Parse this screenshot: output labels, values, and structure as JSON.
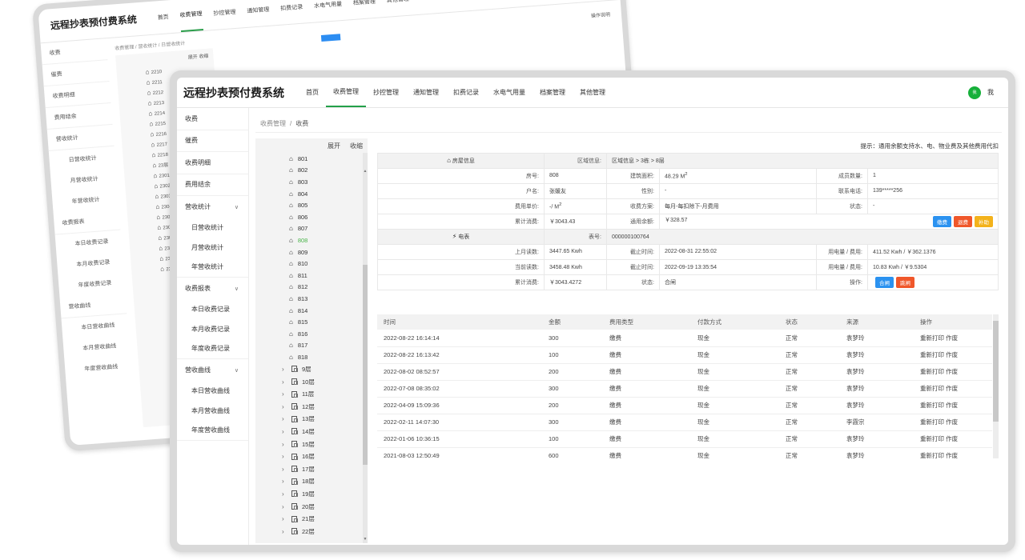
{
  "back": {
    "title": "远程抄表预付费系统",
    "nav": [
      "首页",
      "收费管理",
      "抄控管理",
      "通知管理",
      "扣费记录",
      "水电气用量",
      "档案管理",
      "其他管理"
    ],
    "sidebar": [
      "收费",
      "催费",
      "收费明细",
      "费用结余",
      "营收统计",
      "日营收统计",
      "月营收统计",
      "年营收统计",
      "收费报表",
      "本日收费记录",
      "本月收费记录",
      "年度收费记录",
      "营收曲线",
      "本日营收曲线",
      "本月营收曲线",
      "年度营收曲线"
    ],
    "crumb": "收费管理  /  营收统计  /  日营收统计",
    "tree": [
      "2210",
      "2211",
      "2212",
      "2213",
      "2214",
      "2215",
      "2216",
      "2217",
      "2218",
      "23层",
      "2301",
      "2302",
      "2303",
      "2304",
      "2305",
      "2306",
      "2307",
      "2308",
      "2309",
      "231"
    ],
    "tree_head": "展开  收缩",
    "tip": "操作说明"
  },
  "app": {
    "title": "远程抄表预付费系统",
    "user": "我",
    "avatar_text": "我",
    "nav": [
      {
        "label": "首页",
        "active": false
      },
      {
        "label": "收费管理",
        "active": true
      },
      {
        "label": "抄控管理",
        "active": false
      },
      {
        "label": "通知管理",
        "active": false
      },
      {
        "label": "扣费记录",
        "active": false
      },
      {
        "label": "水电气用量",
        "active": false
      },
      {
        "label": "档案管理",
        "active": false
      },
      {
        "label": "其他管理",
        "active": false
      }
    ]
  },
  "sidebar": {
    "top": [
      "收费",
      "催费",
      "收费明细",
      "费用结余"
    ],
    "groups": [
      {
        "label": "营收统计",
        "items": [
          "日营收统计",
          "月营收统计",
          "年营收统计"
        ]
      },
      {
        "label": "收费报表",
        "items": [
          "本日收费记录",
          "本月收费记录",
          "年度收费记录"
        ]
      },
      {
        "label": "营收曲线",
        "items": [
          "本日营收曲线",
          "本月营收曲线",
          "年度营收曲线"
        ]
      }
    ]
  },
  "breadcrumb": {
    "root": "收费管理",
    "current": "收费"
  },
  "tree": {
    "expand": "展开",
    "collapse": "收缩",
    "rooms": [
      "801",
      "802",
      "803",
      "804",
      "805",
      "806",
      "807",
      "808",
      "809",
      "810",
      "811",
      "812",
      "813",
      "814",
      "815",
      "816",
      "817",
      "818"
    ],
    "selected_room": "808",
    "floors": [
      "9层",
      "10层",
      "11层",
      "12层",
      "13层",
      "14层",
      "15层",
      "16层",
      "17层",
      "18层",
      "19层",
      "20层",
      "21层",
      "22层"
    ]
  },
  "tip": "提示：通用余额支持水、电、物业费及其他费用代扣",
  "house": {
    "section_title": "房屋信息",
    "region_label": "区域信息:",
    "region_value": "区域信息 > 3栋 > 8层",
    "room_no_label": "房号:",
    "room_no": "808",
    "area_label": "建筑面积:",
    "area": "48.29 M",
    "members_label": "成员数量:",
    "members": "1",
    "owner_label": "户名:",
    "owner": "张媛友",
    "gender_label": "性别:",
    "gender": "-",
    "phone_label": "联系电话:",
    "phone": "139*****256",
    "unit_price_label": "费用单价:",
    "unit_price": "-/ M",
    "scheme_label": "收费方案:",
    "scheme": "每月-每扣除下-月费用",
    "status_label": "状态:",
    "status": "-",
    "total_consume_label": "累计消费:",
    "total_consume": "￥3043.43",
    "balance_label": "通用余额:",
    "balance": "￥328.57",
    "btn_pay": "缴费",
    "btn_refund": "退费",
    "btn_supplement": "补助"
  },
  "meter": {
    "section_title": "电表",
    "meter_no_label": "表号:",
    "meter_no": "000000100764",
    "last_read_label": "上月读数:",
    "last_read": "3447.65 Kwh",
    "cutoff1_label": "截止时间:",
    "cutoff1": "2022-08-31 22:55:02",
    "usage1_label": "用电量 / 费用:",
    "usage1": "411.52 Kwh / ￥362.1376",
    "cur_read_label": "当前读数:",
    "cur_read": "3458.48 Kwh",
    "cutoff2_label": "截止时间:",
    "cutoff2": "2022-09-19 13:35:54",
    "usage2_label": "用电量 / 费用:",
    "usage2": "10.83 Kwh / ￥9.5304",
    "total_label": "累计消费:",
    "total": "￥3043.4272",
    "state_label": "状态:",
    "state": "合闸",
    "op_label": "操作:",
    "btn_close": "合闸",
    "btn_open": "跳闸"
  },
  "records": {
    "columns": [
      "时间",
      "金额",
      "费用类型",
      "付款方式",
      "状态",
      "来源",
      "操作"
    ],
    "rows": [
      [
        "2022-08-22 16:14:14",
        "300",
        "缴费",
        "现金",
        "正常",
        "袁梦玲",
        "重新打印 作废"
      ],
      [
        "2022-08-22 16:13:42",
        "100",
        "缴费",
        "现金",
        "正常",
        "袁梦玲",
        "重新打印 作废"
      ],
      [
        "2022-08-02 08:52:57",
        "200",
        "缴费",
        "现金",
        "正常",
        "袁梦玲",
        "重新打印 作废"
      ],
      [
        "2022-07-08 08:35:02",
        "300",
        "缴费",
        "现金",
        "正常",
        "袁梦玲",
        "重新打印 作废"
      ],
      [
        "2022-04-09 15:09:36",
        "200",
        "缴费",
        "现金",
        "正常",
        "袁梦玲",
        "重新打印 作废"
      ],
      [
        "2022-02-11 14:07:30",
        "300",
        "缴费",
        "现金",
        "正常",
        "李霞宗",
        "重新打印 作废"
      ],
      [
        "2022-01-06 10:36:15",
        "100",
        "缴费",
        "现金",
        "正常",
        "袁梦玲",
        "重新打印 作废"
      ],
      [
        "2021-08-03 12:50:49",
        "600",
        "缴费",
        "现金",
        "正常",
        "袁梦玲",
        "重新打印 作废"
      ]
    ]
  },
  "colors": {
    "accent": "#23a049",
    "blue": "#2b92f0",
    "red": "#f0572a",
    "yellow": "#f3b21b"
  }
}
